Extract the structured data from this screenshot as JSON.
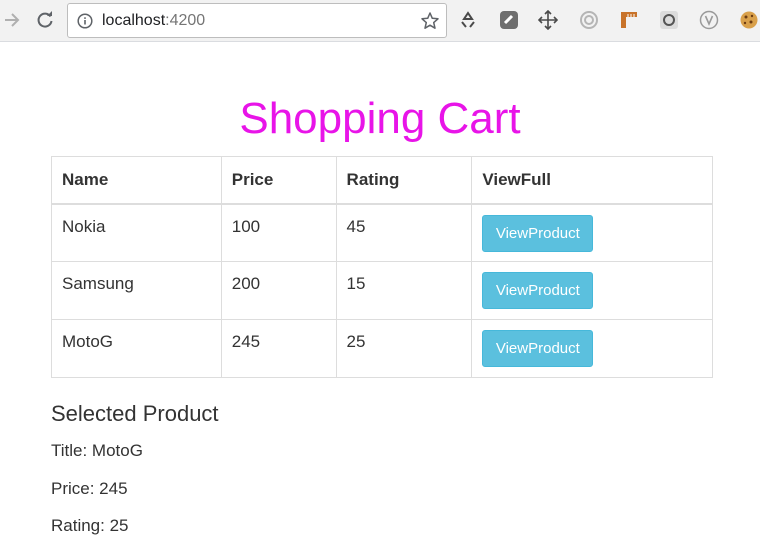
{
  "browser": {
    "url_host": "localhost",
    "url_port": ":4200"
  },
  "page": {
    "title": "Shopping Cart",
    "title_color": "#e814e8"
  },
  "table": {
    "headers": [
      "Name",
      "Price",
      "Rating",
      "ViewFull"
    ],
    "rows": [
      {
        "name": "Nokia",
        "price": "100",
        "rating": "45",
        "button": "ViewProduct"
      },
      {
        "name": "Samsung",
        "price": "200",
        "rating": "15",
        "button": "ViewProduct"
      },
      {
        "name": "MotoG",
        "price": "245",
        "rating": "25",
        "button": "ViewProduct"
      }
    ],
    "button_color": "#5bc0de"
  },
  "selected": {
    "heading": "Selected Product",
    "title_line": "Title: MotoG",
    "price_line": "Price: 245",
    "rating_line": "Rating: 25"
  },
  "icons": {
    "nav": [
      "forward-arrow-icon",
      "reload-icon"
    ],
    "omnibox": [
      "info-icon",
      "bookmark-star-icon"
    ],
    "extensions": [
      "recycle-icon",
      "square-extension-icon",
      "move-cross-icon",
      "circle-target-icon",
      "ruler-icon",
      "rounded-square-icon",
      "v-circle-icon",
      "cookie-icon"
    ]
  }
}
